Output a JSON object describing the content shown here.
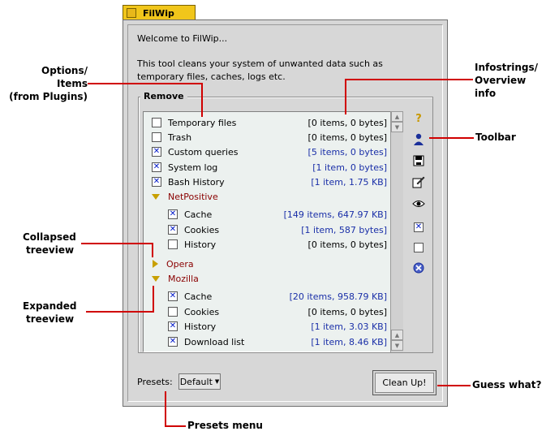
{
  "window": {
    "title": "FilWip"
  },
  "intro": {
    "welcome": "Welcome to FilWip...",
    "description": "This tool cleans your system of unwanted data such as temporary files, caches, logs etc."
  },
  "group": {
    "legend": "Remove"
  },
  "items": [
    {
      "label": "Temporary files",
      "checked": false,
      "info": "[0 items, 0 bytes]",
      "info_blue": false
    },
    {
      "label": "Trash",
      "checked": false,
      "info": "[0 items, 0 bytes]",
      "info_blue": false
    },
    {
      "label": "Custom queries",
      "checked": true,
      "info": "[5 items, 0 bytes]",
      "info_blue": true
    },
    {
      "label": "System log",
      "checked": true,
      "info": "[1 item, 0 bytes]",
      "info_blue": true
    },
    {
      "label": "Bash History",
      "checked": true,
      "info": "[1 item, 1.75 KB]",
      "info_blue": true
    }
  ],
  "netpositive": {
    "label": "NetPositive",
    "children": [
      {
        "label": "Cache",
        "checked": true,
        "info": "[149 items, 647.97 KB]"
      },
      {
        "label": "Cookies",
        "checked": true,
        "info": "[1 item, 587 bytes]"
      },
      {
        "label": "History",
        "checked": false,
        "info": "[0 items, 0 bytes]"
      }
    ]
  },
  "opera": {
    "label": "Opera"
  },
  "mozilla": {
    "label": "Mozilla",
    "children": [
      {
        "label": "Cache",
        "checked": true,
        "info": "[20 items, 958.79 KB]"
      },
      {
        "label": "Cookies",
        "checked": false,
        "info": "[0 items, 0 bytes]"
      },
      {
        "label": "History",
        "checked": true,
        "info": "[1 item, 3.03 KB]"
      },
      {
        "label": "Download list",
        "checked": true,
        "info": "[1 item, 8.46 KB]"
      }
    ]
  },
  "toolbar": {
    "icons": [
      "help-icon",
      "user-icon",
      "save-icon",
      "edit-icon",
      "eye-icon",
      "check-all-icon",
      "uncheck-all-icon",
      "cancel-icon"
    ]
  },
  "presets": {
    "label": "Presets:",
    "value": "Default"
  },
  "cleanup": {
    "label": "Clean Up!"
  },
  "annotations": {
    "options_line1": "Options/",
    "options_line2": "Items",
    "options_line3": "(from Plugins)",
    "info_line1": "Infostrings/",
    "info_line2": "Overview",
    "info_line3": "info",
    "toolbar": "Toolbar",
    "collapsed_line1": "Collapsed",
    "collapsed_line2": "treeview",
    "expanded_line1": "Expanded",
    "expanded_line2": "treeview",
    "guess": "Guess what?",
    "presets_menu": "Presets menu"
  },
  "colors": {
    "tab": "#f1c61b",
    "window_bg": "#d7d7d7",
    "list_bg": "#ecf1ef",
    "info_blue": "#1a2fa8",
    "group_red": "#8a0000",
    "annotation_line": "#d00000"
  }
}
